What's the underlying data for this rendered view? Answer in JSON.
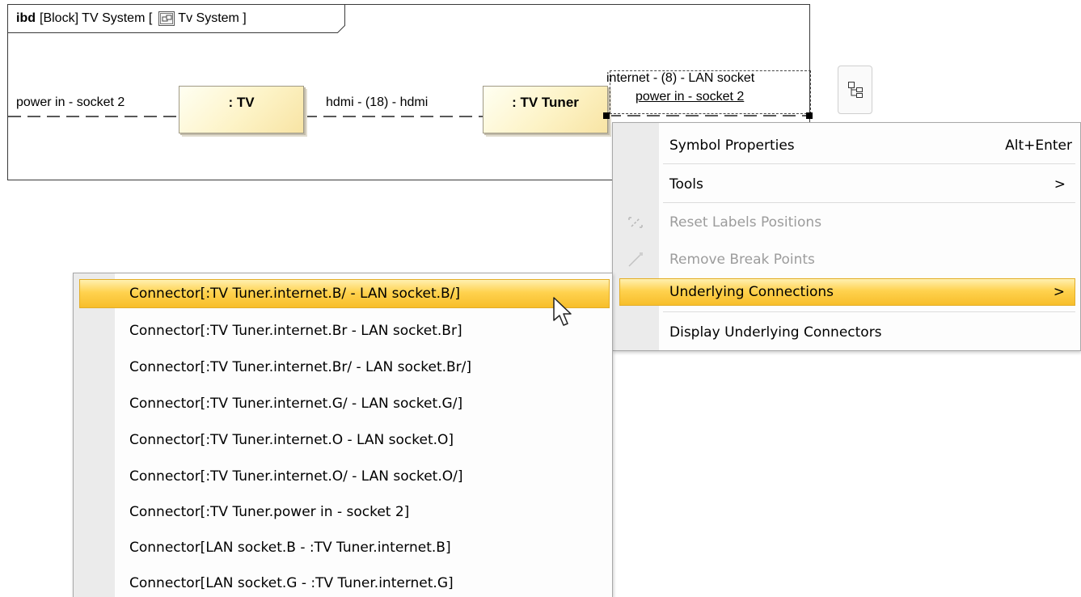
{
  "diagram": {
    "frame_kind": "ibd",
    "frame_title": "[Block] TV System [",
    "frame_block_name": "Tv System ]",
    "left_connector_label": "power in - socket 2",
    "middle_connector_label": "hdmi - (18) - hdmi",
    "selected_connector_label_1": "internet - (8) - LAN socket",
    "selected_connector_label_2": "power in - socket 2",
    "parts": [
      {
        "name": ": TV"
      },
      {
        "name": ": TV Tuner"
      }
    ]
  },
  "context_menu": {
    "items": [
      {
        "label": "Symbol Properties",
        "shortcut": "Alt+Enter",
        "enabled": true
      },
      {
        "label": "Tools",
        "arrow": ">",
        "enabled": true
      },
      {
        "label": "Reset Labels Positions",
        "enabled": false,
        "icon": "reset-labels-icon"
      },
      {
        "label": "Remove Break Points",
        "enabled": false,
        "icon": "remove-break-points-icon"
      },
      {
        "label": "Underlying Connections",
        "arrow": ">",
        "enabled": true,
        "highlighted": true
      },
      {
        "label": "Display Underlying Connectors",
        "enabled": true
      }
    ]
  },
  "submenu": {
    "items": [
      {
        "label": "Connector[:TV Tuner.internet.B/ - LAN socket.B/]",
        "highlighted": true
      },
      {
        "label": "Connector[:TV Tuner.internet.Br - LAN socket.Br]"
      },
      {
        "label": "Connector[:TV Tuner.internet.Br/ - LAN socket.Br/]"
      },
      {
        "label": "Connector[:TV Tuner.internet.G/ - LAN socket.G/]"
      },
      {
        "label": "Connector[:TV Tuner.internet.O - LAN socket.O]"
      },
      {
        "label": "Connector[:TV Tuner.internet.O/ - LAN socket.O/]"
      },
      {
        "label": "Connector[:TV Tuner.power in - socket 2]"
      },
      {
        "label": "Connector[LAN socket.B - :TV Tuner.internet.B]"
      },
      {
        "label": "Connector[LAN socket.G - :TV Tuner.internet.G]"
      }
    ]
  },
  "colors": {
    "highlight": "#ffd24f",
    "part_fill": "#fdf3c6",
    "menu_gutter": "#ebebeb",
    "disabled_text": "#9c9c9c"
  }
}
